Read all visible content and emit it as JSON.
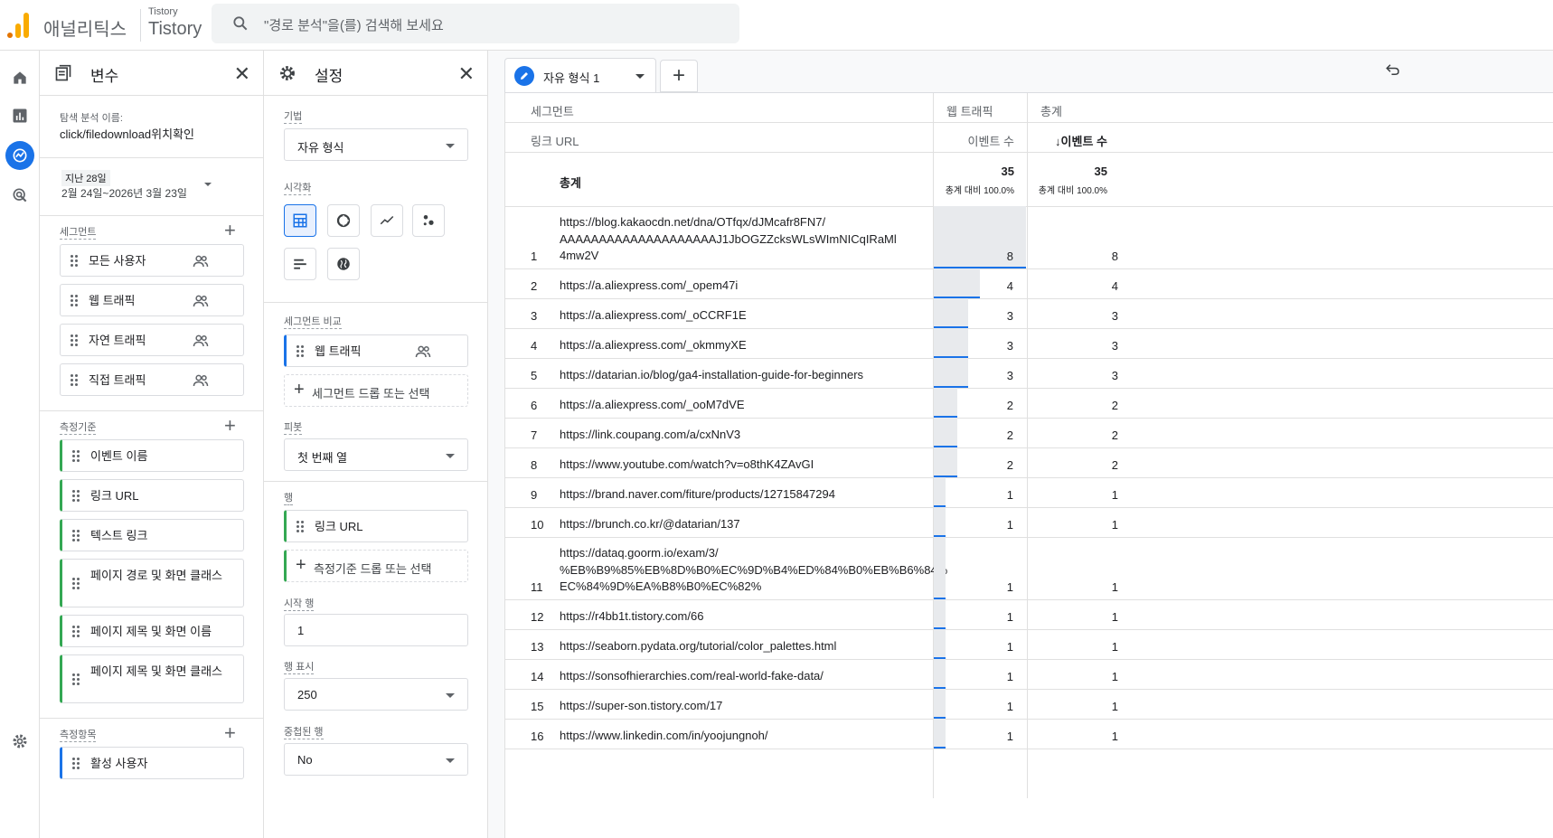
{
  "topbar": {
    "app_name": "애널리틱스",
    "property_account": "Tistory",
    "property_name": "Tistory",
    "search_placeholder": "\"경로 분석\"을(를) 검색해 보세요"
  },
  "variables_panel": {
    "title": "변수",
    "exploration_name_label": "탐색 분석 이름:",
    "exploration_name": "click/filedownload위치확인",
    "date_range_label": "지난 28일",
    "date_range": "2월 24일~2026년 3월 23일",
    "segments_label": "세그먼트",
    "segments": [
      "모든 사용자",
      "웹 트래픽",
      "자연 트래픽",
      "직접 트래픽"
    ],
    "dimensions_label": "측정기준",
    "dimensions": [
      "이벤트 이름",
      "링크 URL",
      "텍스트 링크",
      "페이지 경로 및 화면 클래스",
      "페이지 제목 및 화면 이름",
      "페이지 제목 및 화면 클래스"
    ],
    "metrics_label": "측정항목",
    "metrics": [
      "활성 사용자"
    ]
  },
  "settings_panel": {
    "title": "설정",
    "technique_label": "기법",
    "technique_value": "자유 형식",
    "visualization_label": "시각화",
    "segment_compare_label": "세그먼트 비교",
    "segment_compare_chip": "웹 트래픽",
    "segment_drop_text": "세그먼트 드롭 또는 선택",
    "pivot_label": "피봇",
    "pivot_value": "첫 번째 열",
    "rows_label": "행",
    "rows_chip": "링크 URL",
    "rows_drop_text": "측정기준 드롭 또는 선택",
    "start_row_label": "시작 행",
    "start_row_value": "1",
    "show_rows_label": "행 표시",
    "show_rows_value": "250",
    "nested_rows_label": "중첩된 행",
    "nested_rows_value": "No"
  },
  "tabs": {
    "active_tab": "자유 형식 1",
    "add_tab": "+"
  },
  "table": {
    "segment_header": "세그먼트",
    "dimension_header": "링크 URL",
    "col1_segment": "웹 트래픽",
    "col2_segment": "총계",
    "col1_metric": "이벤트 수",
    "col2_metric": "↓이벤트 수",
    "total_label": "총계",
    "total_col1": "35",
    "total_col1_pct": "총계 대비 100.0%",
    "total_col2": "35",
    "total_col2_pct": "총계 대비 100.0%",
    "rows": [
      {
        "num": "1",
        "url": "https://blog.kakaocdn.net/dna/OTfqx/dJMcafr8FN7/\nAAAAAAAAAAAAAAAAAAAAJ1JbOGZZcksWLsWImNICqIRaMl\n4mw2V",
        "v1": "8",
        "v2": "8",
        "share": 1.0
      },
      {
        "num": "2",
        "url": "https://a.aliexpress.com/_opem47i",
        "v1": "4",
        "v2": "4",
        "share": 0.5
      },
      {
        "num": "3",
        "url": "https://a.aliexpress.com/_oCCRF1E",
        "v1": "3",
        "v2": "3",
        "share": 0.375
      },
      {
        "num": "4",
        "url": "https://a.aliexpress.com/_okmmyXE",
        "v1": "3",
        "v2": "3",
        "share": 0.375
      },
      {
        "num": "5",
        "url": "https://datarian.io/blog/ga4-installation-guide-for-beginners",
        "v1": "3",
        "v2": "3",
        "share": 0.375
      },
      {
        "num": "6",
        "url": "https://a.aliexpress.com/_ooM7dVE",
        "v1": "2",
        "v2": "2",
        "share": 0.25
      },
      {
        "num": "7",
        "url": "https://link.coupang.com/a/cxNnV3",
        "v1": "2",
        "v2": "2",
        "share": 0.25
      },
      {
        "num": "8",
        "url": "https://www.youtube.com/watch?v=o8thK4ZAvGI",
        "v1": "2",
        "v2": "2",
        "share": 0.25
      },
      {
        "num": "9",
        "url": "https://brand.naver.com/fiture/products/12715847294",
        "v1": "1",
        "v2": "1",
        "share": 0.125
      },
      {
        "num": "10",
        "url": "https://brunch.co.kr/@datarian/137",
        "v1": "1",
        "v2": "1",
        "share": 0.125
      },
      {
        "num": "11",
        "url": "https://dataq.goorm.io/exam/3/\n%EB%B9%85%EB%8D%B0%EC%9D%B4%ED%84%B0%EB%B6%84%\nEC%84%9D%EA%B8%B0%EC%82%",
        "v1": "1",
        "v2": "1",
        "share": 0.125
      },
      {
        "num": "12",
        "url": "https://r4bb1t.tistory.com/66",
        "v1": "1",
        "v2": "1",
        "share": 0.125
      },
      {
        "num": "13",
        "url": "https://seaborn.pydata.org/tutorial/color_palettes.html",
        "v1": "1",
        "v2": "1",
        "share": 0.125
      },
      {
        "num": "14",
        "url": "https://sonsofhierarchies.com/real-world-fake-data/",
        "v1": "1",
        "v2": "1",
        "share": 0.125
      },
      {
        "num": "15",
        "url": "https://super-son.tistory.com/17",
        "v1": "1",
        "v2": "1",
        "share": 0.125
      },
      {
        "num": "16",
        "url": "https://www.linkedin.com/in/yoojungnoh/",
        "v1": "1",
        "v2": "1",
        "share": 0.125
      }
    ]
  },
  "colors": {
    "accent": "#1a73e8",
    "segment_green": "#34a853",
    "logo_orange": "#f9ab00"
  }
}
